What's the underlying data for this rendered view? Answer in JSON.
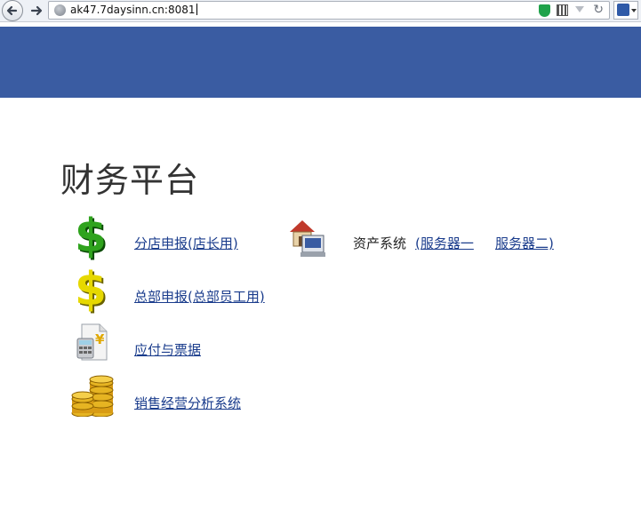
{
  "browser": {
    "url": "ak47.7daysinn.cn:8081",
    "icons": [
      "back-icon",
      "forward-icon",
      "globe-icon",
      "shield-icon",
      "qr-code-icon",
      "dropdown-icon",
      "reload-icon",
      "search-engine-icon"
    ],
    "accent": "#3a5ca2"
  },
  "page": {
    "title": "财务平台",
    "items": [
      {
        "label": "分店申报(店长用)",
        "icon": "dollar-green-icon"
      },
      {
        "label": "总部申报(总部员工用)",
        "icon": "dollar-yellow-icon"
      },
      {
        "label": "应付与票据",
        "icon": "calculator-yen-icon"
      },
      {
        "label": "销售经营分析系统",
        "icon": "coin-stack-icon"
      }
    ],
    "asset": {
      "label": "资产系统",
      "links": [
        "(服务器一",
        "服务器二)"
      ],
      "icon": "house-computer-icon"
    },
    "colors": {
      "banner": "#3a5ca2",
      "link": "#1a3c8c",
      "text": "#333333"
    }
  }
}
